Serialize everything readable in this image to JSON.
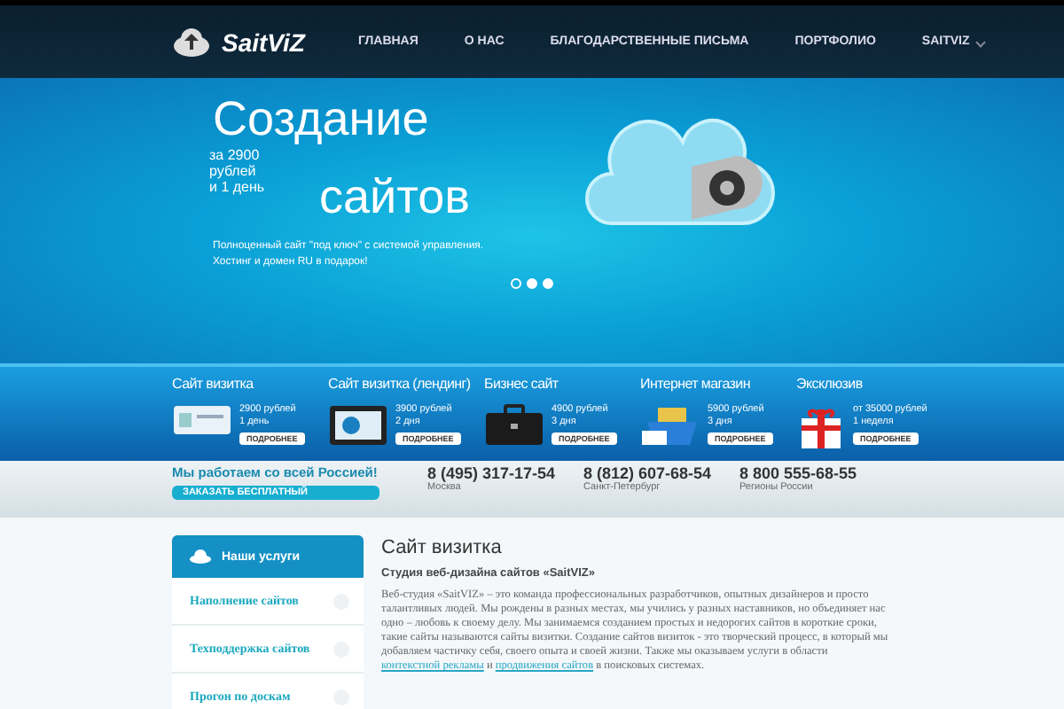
{
  "header": {
    "logo": "SaitViZ",
    "nav": [
      {
        "label": "ГЛАВНАЯ",
        "dropdown": false
      },
      {
        "label": "О НАС",
        "dropdown": false
      },
      {
        "label": "БЛАГОДАРСТВЕННЫЕ ПИСЬМА",
        "dropdown": false
      },
      {
        "label": "ПОРТФОЛИО",
        "dropdown": false
      },
      {
        "label": "SAITVIZ",
        "dropdown": true
      }
    ]
  },
  "hero": {
    "title_1": "Создание",
    "price": "за 2900\nрублей\nи 1 день",
    "title_2": "сайтов",
    "text": "Полноценный сайт \"под ключ\" с системой управления.\nХостинг и домен RU в подарок!",
    "dots": [
      {
        "selected": true
      },
      {
        "selected": false
      },
      {
        "selected": false
      }
    ]
  },
  "services": [
    {
      "kind": "card",
      "title": "Сайт визитка",
      "price": "2900 рублей",
      "term": "1 день",
      "button": "ПОДРОБНЕЕ"
    },
    {
      "kind": "tablet",
      "title": "Сайт визитка (лендинг)",
      "price": "3900 рублей",
      "term": "2 дня",
      "button": "ПОДРОБНЕЕ"
    },
    {
      "kind": "briefcase",
      "title": "Бизнес сайт",
      "price": "4900 рублей",
      "term": "3 дня",
      "button": "ПОДРОБНЕЕ"
    },
    {
      "kind": "basket",
      "title": "Интернет магазин",
      "price": "5900 рублей",
      "term": "3 дня",
      "button": "ПОДРОБНЕЕ"
    },
    {
      "kind": "gift",
      "title": "Эксклюзив",
      "price": "от 35000 рублей",
      "term": "1 неделя",
      "button": "ПОДРОБНЕЕ"
    }
  ],
  "contacts": {
    "slogan": "Мы работаем со всей Россией!",
    "order_button": "ЗАКАЗАТЬ БЕСПЛАТНЫЙ",
    "phones": [
      {
        "number": "8 (495) 317-17-54",
        "city": "Москва"
      },
      {
        "number": "8 (812) 607-68-54",
        "city": "Санкт-Петербург"
      },
      {
        "number": "8 800 555-68-55",
        "city": "Регионы России"
      }
    ]
  },
  "sidebar": {
    "title": "Наши услуги",
    "items": [
      {
        "label": "Наполнение сайтов"
      },
      {
        "label": "Техподдержка сайтов"
      },
      {
        "label": "Прогон по доскам"
      }
    ]
  },
  "article": {
    "title": "Сайт визитка",
    "subtitle": "Студия веб-дизайна сайтов «SaitVIZ»",
    "text": "Веб-студия «SaitVIZ» – это команда профессиональных разработчиков, опытных дизайнеров и просто талантливых людей. Мы рождены в разных местах, мы учились у разных наставников, но объединяет нас одно – любовь к своему делу. Мы занимаемся созданием простых и недорогих сайтов в короткие сроки, такие сайты называются сайты визитки. Создание сайтов визиток - это творческий процесс, в который мы добавляем частичку себя, своего опыта и своей жизни. Также мы оказываем услуги в области",
    "link_1": "контекстной рекламы",
    "middle": "и",
    "link_2": "продвижения сайтов",
    "end": "в поисковых системах."
  }
}
